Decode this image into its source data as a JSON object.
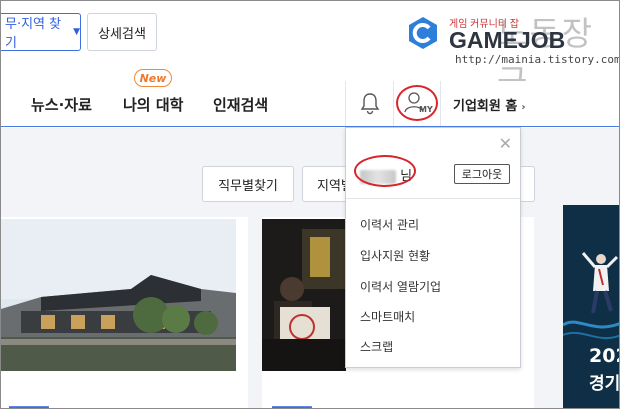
{
  "header": {
    "region_button_label": "무·지역 찾기",
    "detail_search_label": "상세검색"
  },
  "watermark": {
    "small_text": "게임 커뮤니티 잡",
    "brand": "GAMEJOB",
    "korean": "노동장군",
    "url": "http://mainia.tistory.com"
  },
  "nav": {
    "news": "뉴스·자료",
    "my_university": "나의 대학",
    "new_badge": "New",
    "talent_search": "인재검색",
    "my_label": "MY",
    "corporate_home": "기업회원 홈"
  },
  "filters": {
    "job_search": "직무별찾기",
    "region_search": "지역별찾기"
  },
  "dropdown": {
    "user_suffix": "님",
    "logout": "로그아웃",
    "menu": [
      "이력서 관리",
      "입사지원 현황",
      "이력서 열람기업",
      "스마트매치",
      "스크랩"
    ]
  },
  "cards": {
    "right_banner_text_1": "202",
    "right_banner_text_2": "경기"
  },
  "colors": {
    "accent_blue": "#3d6fe0",
    "highlight_red": "#d6262c",
    "new_orange": "#f0782a"
  }
}
